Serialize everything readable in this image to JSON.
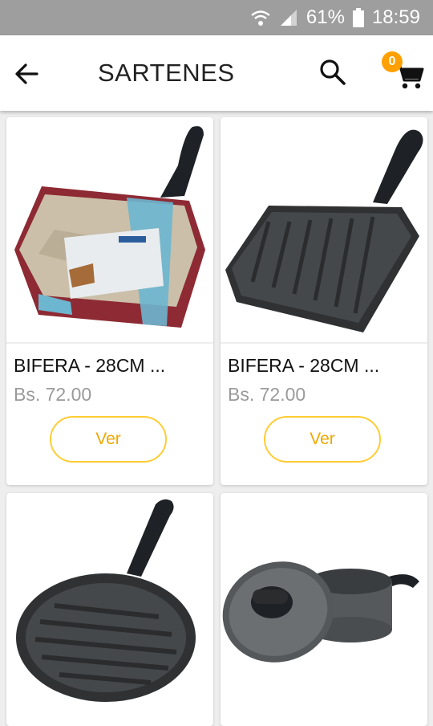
{
  "status": {
    "battery_percent": "61%",
    "time": "18:59"
  },
  "header": {
    "title": "SARTENES",
    "cart_count": "0"
  },
  "products": [
    {
      "name": "BIFERA - 28CM ...",
      "price": "Bs. 72.00",
      "button": "Ver"
    },
    {
      "name": "BIFERA - 28CM ...",
      "price": "Bs. 72.00",
      "button": "Ver"
    },
    {},
    {}
  ],
  "icons": {
    "back": "arrow-left-icon",
    "search": "search-icon",
    "cart": "shopping-cart-icon",
    "wifi": "wifi-icon",
    "signal": "signal-icon",
    "battery": "battery-icon"
  },
  "colors": {
    "accent": "#ffa000",
    "button_border": "#ffcc33",
    "button_text": "#f0a800"
  }
}
